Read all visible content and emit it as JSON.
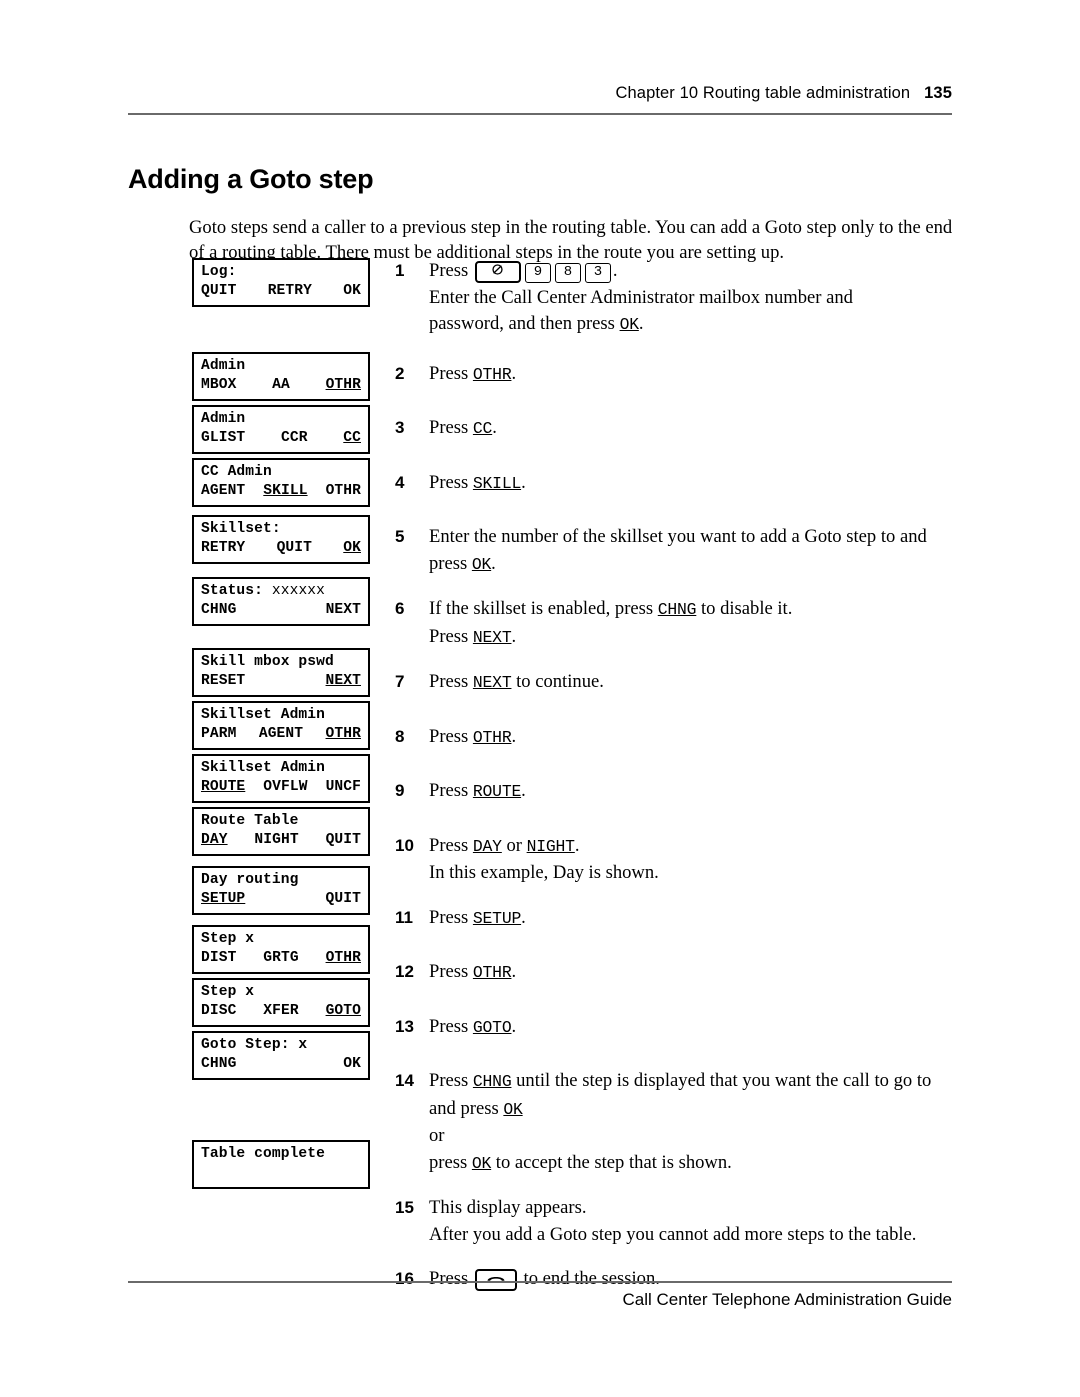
{
  "header": {
    "chapter_label": "Chapter 10  Routing table administration",
    "page_number": "135"
  },
  "title": "Adding a Goto step",
  "intro": "Goto steps send a caller to a previous step in the routing table. You can add a Goto step only to the end of a routing table. There must be additional steps in the route you are setting up.",
  "footer": {
    "guide_title": "Call Center Telephone Administration Guide"
  },
  "keys": {
    "feature": "℘",
    "nine": "9",
    "eight": "8",
    "three": "3",
    "release_icon": "release-handset-icon"
  },
  "displays": [
    {
      "id": "log",
      "line1": "Log:",
      "softkeys": [
        {
          "label": "QUIT",
          "underlined": false
        },
        {
          "label": "RETRY",
          "underlined": false
        },
        {
          "label": "OK",
          "underlined": false
        }
      ]
    },
    {
      "id": "admin-mbox",
      "line1": "Admin",
      "softkeys": [
        {
          "label": "MBOX",
          "underlined": false
        },
        {
          "label": "AA",
          "underlined": false
        },
        {
          "label": "OTHR",
          "underlined": true
        }
      ]
    },
    {
      "id": "admin-glist",
      "line1": "Admin",
      "softkeys": [
        {
          "label": "GLIST",
          "underlined": false
        },
        {
          "label": "CCR",
          "underlined": false
        },
        {
          "label": "CC",
          "underlined": true
        }
      ]
    },
    {
      "id": "cc-admin",
      "line1": "CC Admin",
      "softkeys": [
        {
          "label": "AGENT",
          "underlined": false
        },
        {
          "label": "SKILL",
          "underlined": true
        },
        {
          "label": "OTHR",
          "underlined": false
        }
      ]
    },
    {
      "id": "skillset",
      "line1": "Skillset:",
      "softkeys": [
        {
          "label": "RETRY",
          "underlined": false
        },
        {
          "label": "QUIT",
          "underlined": false
        },
        {
          "label": "OK",
          "underlined": true
        }
      ]
    },
    {
      "id": "status",
      "line1": "Status:",
      "line1_sub": " xxxxxx",
      "softkeys": [
        {
          "label": "CHNG",
          "underlined": false
        },
        {
          "label": "",
          "underlined": false
        },
        {
          "label": "NEXT",
          "underlined": false
        }
      ]
    },
    {
      "id": "skill-mbox-pswd",
      "line1": "Skill mbox pswd",
      "softkeys": [
        {
          "label": "RESET",
          "underlined": false
        },
        {
          "label": "",
          "underlined": false
        },
        {
          "label": "NEXT",
          "underlined": true
        }
      ]
    },
    {
      "id": "skillset-admin-parm",
      "line1": "Skillset Admin",
      "softkeys": [
        {
          "label": "PARM",
          "underlined": false
        },
        {
          "label": "AGENT",
          "underlined": false
        },
        {
          "label": "OTHR",
          "underlined": true
        }
      ]
    },
    {
      "id": "skillset-admin-route",
      "line1": "Skillset Admin",
      "softkeys": [
        {
          "label": "ROUTE",
          "underlined": true
        },
        {
          "label": "OVFLW",
          "underlined": false
        },
        {
          "label": "UNCF",
          "underlined": false
        }
      ]
    },
    {
      "id": "route-table",
      "line1": "Route Table",
      "softkeys": [
        {
          "label": "DAY",
          "underlined": true
        },
        {
          "label": "NIGHT",
          "underlined": false
        },
        {
          "label": "QUIT",
          "underlined": false
        }
      ]
    },
    {
      "id": "day-routing",
      "line1": "Day routing",
      "softkeys": [
        {
          "label": "SETUP",
          "underlined": true
        },
        {
          "label": "",
          "underlined": false
        },
        {
          "label": "QUIT",
          "underlined": false
        }
      ]
    },
    {
      "id": "step-dist",
      "line1": "Step x",
      "softkeys": [
        {
          "label": "DIST",
          "underlined": false
        },
        {
          "label": "GRTG",
          "underlined": false
        },
        {
          "label": "OTHR",
          "underlined": true
        }
      ]
    },
    {
      "id": "step-disc",
      "line1": "Step x",
      "softkeys": [
        {
          "label": "DISC",
          "underlined": false
        },
        {
          "label": "XFER",
          "underlined": false
        },
        {
          "label": "GOTO",
          "underlined": true
        }
      ]
    },
    {
      "id": "goto-step",
      "line1": "Goto Step: x",
      "softkeys": [
        {
          "label": "CHNG",
          "underlined": false
        },
        {
          "label": "",
          "underlined": false
        },
        {
          "label": "OK",
          "underlined": false
        }
      ]
    },
    {
      "id": "table-complete",
      "line1": "Table complete",
      "softkeys": [
        {
          "label": "",
          "underlined": false
        },
        {
          "label": "",
          "underlined": false
        },
        {
          "label": "",
          "underlined": false
        }
      ]
    }
  ],
  "steps": [
    {
      "num": "1",
      "lines": [
        "Press  [feature] [9] [8] [3] .",
        "Enter the Call Center Administrator mailbox number and",
        "password, and then press OK."
      ],
      "text_plain": "Press ℘ 9 8 3. Enter the Call Center Administrator mailbox number and password, and then press OK."
    },
    {
      "num": "2",
      "lines": [
        "Press OTHR."
      ],
      "text_plain": "Press OTHR."
    },
    {
      "num": "3",
      "lines": [
        "Press CC."
      ],
      "text_plain": "Press CC."
    },
    {
      "num": "4",
      "lines": [
        "Press SKILL."
      ],
      "text_plain": "Press SKILL."
    },
    {
      "num": "5",
      "lines": [
        "Enter the number of the skillset you want to add a Goto step to and",
        "press OK."
      ],
      "text_plain": "Enter the number of the skillset you want to add a Goto step to and press OK."
    },
    {
      "num": "6",
      "lines": [
        "If the skillset is enabled, press CHNG to disable it.",
        "Press NEXT."
      ],
      "text_plain": "If the skillset is enabled, press CHNG to disable it. Press NEXT."
    },
    {
      "num": "7",
      "lines": [
        "Press NEXT to continue."
      ],
      "text_plain": "Press NEXT to continue."
    },
    {
      "num": "8",
      "lines": [
        "Press OTHR."
      ],
      "text_plain": "Press OTHR."
    },
    {
      "num": "9",
      "lines": [
        "Press ROUTE."
      ],
      "text_plain": "Press ROUTE."
    },
    {
      "num": "10",
      "lines": [
        "Press DAY or NIGHT.",
        "In this example, Day is shown."
      ],
      "text_plain": "Press DAY or NIGHT. In this example, Day is shown."
    },
    {
      "num": "11",
      "lines": [
        "Press  SETUP."
      ],
      "text_plain": "Press SETUP."
    },
    {
      "num": "12",
      "lines": [
        "Press OTHR."
      ],
      "text_plain": "Press OTHR."
    },
    {
      "num": "13",
      "lines": [
        "Press GOTO."
      ],
      "text_plain": "Press GOTO."
    },
    {
      "num": "14",
      "lines": [
        "Press CHNG until the step is displayed that you want the call to go to",
        "and press OK",
        "or",
        "press OK to accept the step that is shown."
      ],
      "text_plain": "Press CHNG until the step is displayed that you want the call to go to and press OK or press OK to accept the step that is shown."
    },
    {
      "num": "15",
      "lines": [
        "This display appears.",
        "After you add a Goto step you cannot add more steps to the table."
      ],
      "text_plain": "This display appears. After you add a Goto step you cannot add more steps to the table."
    },
    {
      "num": "16",
      "lines": [
        "Press [release] to end the session."
      ],
      "text_plain": "Press [release] to end the session."
    }
  ],
  "step_fragments": {
    "press": "Press",
    "press_sp": "Press ",
    "period": ".",
    "or_word": "or",
    "s1_l2": "Enter the Call Center Administrator mailbox number and",
    "s1_l3a": "password, and then press ",
    "s1_ok": "OK",
    "s2_key": "OTHR",
    "s3_key": "CC",
    "s4_key": "SKILL",
    "s5_l1": "Enter the number of the skillset you want to add a Goto step to and",
    "s5_l2a": "press ",
    "s5_ok": "OK",
    "s6_l1a": "If the skillset is enabled, press ",
    "s6_chng": "CHNG",
    "s6_l1b": " to disable it.",
    "s6_next": "NEXT",
    "s7_next": "NEXT",
    "s7_tail": " to continue.",
    "s8_key": "OTHR",
    "s9_key": "ROUTE",
    "s10_day": "DAY",
    "s10_or": " or ",
    "s10_night": "NIGHT",
    "s10_l2": "In this example, Day is shown.",
    "s11_key": "SETUP",
    "s12_key": "OTHR",
    "s13_key": "GOTO",
    "s14_l1a": "Press ",
    "s14_chng": "CHNG",
    "s14_l1b": " until the step is displayed that you want the call to go to",
    "s14_l2a": "and press ",
    "s14_ok": "OK",
    "s14_l4a": "press ",
    "s14_ok2": "OK",
    "s14_l4b": " to accept the step that is shown.",
    "s15_l1": "This display appears.",
    "s15_l2": "After you add a Goto step you cannot add more steps to the table.",
    "s16_tail": " to end the session."
  }
}
